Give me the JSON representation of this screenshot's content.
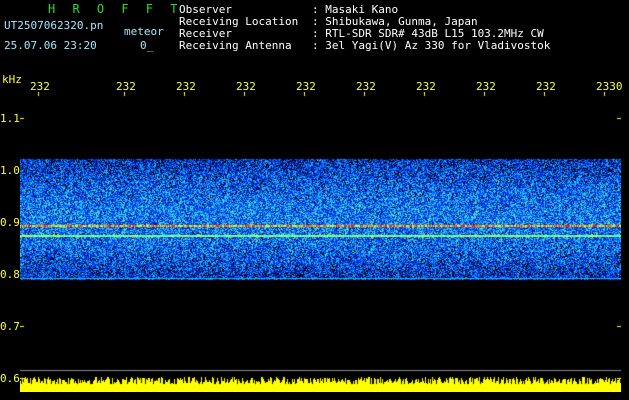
{
  "app": {
    "title": "H R O F F T",
    "filename": "UT2507062320.pn",
    "mode": "meteor",
    "datetime": "25.07.06 23:20",
    "counter": "0_"
  },
  "header": {
    "fields": [
      {
        "label": "Observer",
        "value": ": Masaki Kano"
      },
      {
        "label": "Receiving Location",
        "value": ": Shibukawa, Gunma, Japan"
      },
      {
        "label": "Receiver",
        "value": ": RTL-SDR SDR# 43dB L15 103.2MHz CW"
      },
      {
        "label": "Receiving Antenna",
        "value": ": 3el Yagi(V) Az 330 for Vladivostok"
      }
    ]
  },
  "axes": {
    "y_unit": "kHz",
    "y_ticks": [
      "1.1",
      "1.0",
      "0.9",
      "0.8",
      "0.7",
      "0.6"
    ],
    "x_ticks": [
      "232",
      "232",
      "232",
      "232",
      "232",
      "232",
      "232",
      "232",
      "232",
      "2330"
    ]
  },
  "colors": {
    "background": "#000000",
    "tick_text": "#ffff33",
    "title": "#22dd33",
    "fields": "#ffffff"
  },
  "chart_data": {
    "type": "heatmap",
    "ylabel": "kHz",
    "ylim": [
      0.6,
      1.15
    ],
    "band_range": [
      0.79,
      1.02
    ],
    "strong_lines": [
      0.895,
      0.875
    ],
    "x_tick_labels": [
      "232",
      "232",
      "232",
      "232",
      "232",
      "232",
      "232",
      "232",
      "232",
      "2330"
    ]
  }
}
